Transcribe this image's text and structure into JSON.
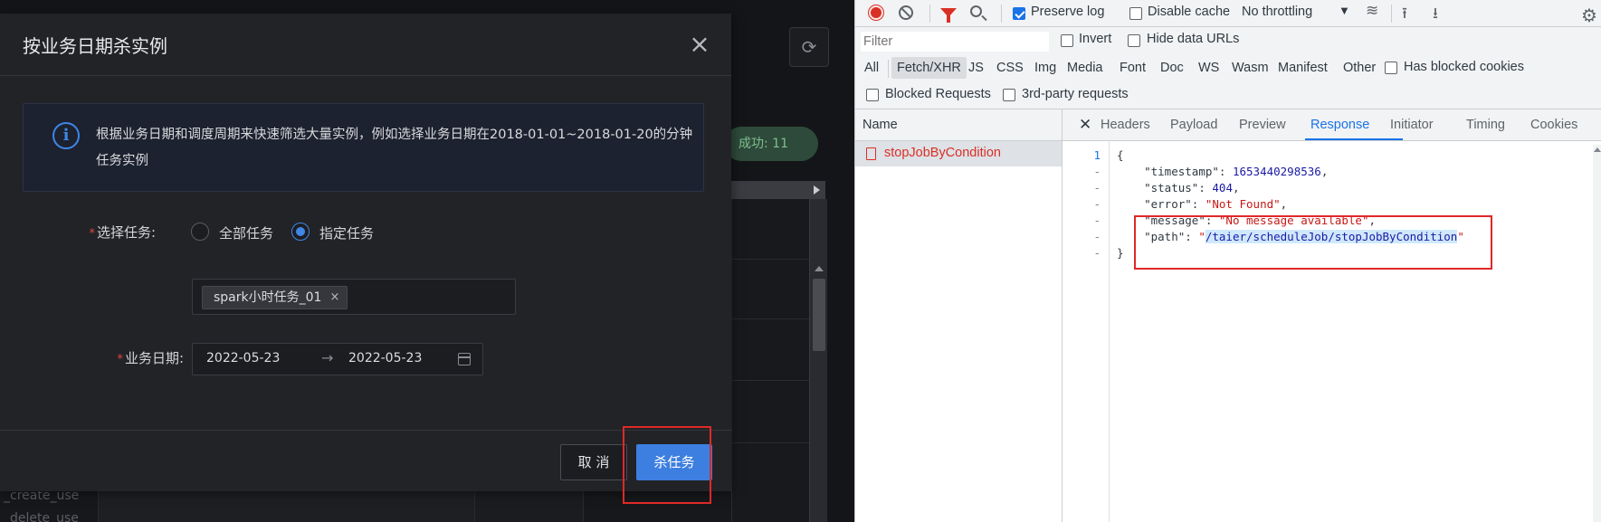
{
  "background_app": {
    "refresh_icon": "refresh-icon",
    "success_badge": "成功: 11",
    "bottom_texts": [
      "_create_use",
      "_delete_use"
    ]
  },
  "modal": {
    "title": "按业务日期杀实例",
    "close_icon": "close-icon",
    "info_text": "根据业务日期和调度周期来快速筛选大量实例，例如选择业务日期在2018-01-01~2018-01-20的分钟任务实例",
    "select_task_label": "选择任务:",
    "radio_options": [
      {
        "label": "全部任务",
        "checked": false
      },
      {
        "label": "指定任务",
        "checked": true
      }
    ],
    "selected_tag": "spark小时任务_01",
    "tag_close": "×",
    "biz_date_label": "业务日期:",
    "date_start": "2022-05-23",
    "date_sep": "→",
    "date_end": "2022-05-23",
    "cancel_label": "取 消",
    "kill_label": "杀任务",
    "colors": {
      "primary": "#3d7fe0",
      "required": "#e0473b",
      "highlight_frame": "#e02828"
    }
  },
  "devtools": {
    "toolbar": {
      "preserve_log_label": "Preserve log",
      "preserve_log": true,
      "disable_cache_label": "Disable cache",
      "disable_cache": false,
      "throttling": "No throttling",
      "icons": [
        "record-icon",
        "clear-icon",
        "filter-icon",
        "search-icon",
        "wifi-icon",
        "upload-icon",
        "download-icon",
        "gear-icon"
      ]
    },
    "filter_row": {
      "placeholder": "Filter",
      "invert_label": "Invert",
      "hide_data_urls_label": "Hide data URLs"
    },
    "type_filters": [
      "All",
      "Fetch/XHR",
      "JS",
      "CSS",
      "Img",
      "Media",
      "Font",
      "Doc",
      "WS",
      "Wasm",
      "Manifest",
      "Other"
    ],
    "active_type": "Fetch/XHR",
    "has_blocked_cookies_label": "Has blocked cookies",
    "blocked_requests_label": "Blocked Requests",
    "third_party_label": "3rd-party requests",
    "name_header": "Name",
    "request_name": "stopJobByCondition",
    "detail_tabs": [
      "Headers",
      "Payload",
      "Preview",
      "Response",
      "Initiator",
      "Timing",
      "Cookies"
    ],
    "active_tab": "Response",
    "response": {
      "gutter": [
        "1",
        "-",
        "-",
        "-",
        "-",
        "-",
        "-"
      ],
      "timestamp_key": "\"timestamp\"",
      "timestamp": "1653440298536",
      "status_key": "\"status\"",
      "status": "404",
      "error_key": "\"error\"",
      "error": "\"Not Found\"",
      "message_key": "\"message\"",
      "message": "\"No message available\"",
      "path_key": "\"path\"",
      "path": "/taier/scheduleJob/stopJobByCondition"
    }
  }
}
